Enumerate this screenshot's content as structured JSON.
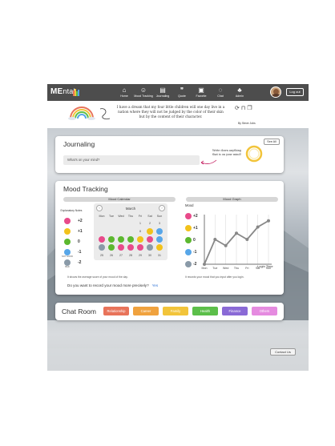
{
  "nav": {
    "logo_main": "ME",
    "logo_rest": "ntal",
    "items": [
      {
        "label": "Home",
        "icon": "home-icon",
        "glyph": "⌂"
      },
      {
        "label": "Mood Tracking",
        "icon": "smiley-icon",
        "glyph": "☺"
      },
      {
        "label": "Journaling",
        "icon": "book-icon",
        "glyph": "▤"
      },
      {
        "label": "Quote",
        "icon": "quote-icon",
        "glyph": "❞"
      },
      {
        "label": "Favorite",
        "icon": "bookmark-icon",
        "glyph": "▣"
      },
      {
        "label": "Chat",
        "icon": "chat-icon",
        "glyph": "◌"
      },
      {
        "label": "Admin",
        "icon": "admin-icon",
        "glyph": "♣"
      }
    ],
    "logout": "Log out"
  },
  "quote": {
    "text": "I have a dream that my four little children will one day live in a nation where they will not be judged by the color of their skin but by the content of their character.",
    "author": "By Steve Jobs"
  },
  "journaling": {
    "title": "Journaling",
    "see_all": "See All",
    "placeholder": "What's on your mind?",
    "note": "Write down anything that is on your mind!"
  },
  "mood": {
    "title": "Mood Tracking",
    "calendar_label": "Mood Calendar",
    "graph_label": "Mood Graph",
    "legend_title": "Explanatory Notes",
    "legend": [
      {
        "value": "+2",
        "caption": "",
        "color": "#e84a8a"
      },
      {
        "value": "+1",
        "caption": "",
        "color": "#f2c21b"
      },
      {
        "value": "0",
        "caption": "",
        "color": "#5cb82f"
      },
      {
        "value": "-1",
        "caption": "NOT GOOD",
        "color": "#57a6e8"
      },
      {
        "value": "-2",
        "caption": "BAD",
        "color": "#8a9aa8"
      }
    ],
    "calendar": {
      "month": "March",
      "weekdays": [
        "Mon",
        "Tue",
        "Wed",
        "Thu",
        "Fri",
        "Sat",
        "Sun"
      ],
      "cells": [
        {
          "row": 0,
          "col": 4,
          "day": "1"
        },
        {
          "row": 0,
          "col": 5,
          "day": "2"
        },
        {
          "row": 0,
          "col": 6,
          "day": "3"
        },
        {
          "row": 1,
          "col": 4,
          "day": "8"
        },
        {
          "row": 1,
          "col": 5,
          "day": "9",
          "mood": "+1"
        },
        {
          "row": 1,
          "col": 6,
          "day": "10",
          "mood": "-1"
        },
        {
          "row": 2,
          "col": 0,
          "mood": "+2"
        },
        {
          "row": 2,
          "col": 1,
          "mood": "0"
        },
        {
          "row": 2,
          "col": 2,
          "mood": "0"
        },
        {
          "row": 2,
          "col": 3,
          "mood": "0"
        },
        {
          "row": 2,
          "col": 4,
          "mood": "+1"
        },
        {
          "row": 2,
          "col": 5,
          "mood": "+2"
        },
        {
          "row": 2,
          "col": 6,
          "mood": "-1"
        },
        {
          "row": 3,
          "col": 0,
          "mood": "-2"
        },
        {
          "row": 3,
          "col": 1,
          "mood": "0"
        },
        {
          "row": 3,
          "col": 2,
          "mood": "+2"
        },
        {
          "row": 3,
          "col": 3,
          "mood": "+2"
        },
        {
          "row": 3,
          "col": 4,
          "mood": "+2"
        },
        {
          "row": 3,
          "col": 5,
          "mood": "-2"
        },
        {
          "row": 3,
          "col": 6,
          "mood": "+1"
        },
        {
          "row": 4,
          "col": 0,
          "day": "25"
        },
        {
          "row": 4,
          "col": 1,
          "day": "26"
        },
        {
          "row": 4,
          "col": 2,
          "day": "27"
        },
        {
          "row": 4,
          "col": 3,
          "day": "28"
        },
        {
          "row": 4,
          "col": 4,
          "day": "29"
        },
        {
          "row": 4,
          "col": 5,
          "day": "30"
        },
        {
          "row": 4,
          "col": 6,
          "day": "31"
        }
      ]
    },
    "calendar_note": "It shows the average score of your mood of the day.",
    "graph_note": "It records your mood that you input after you login.",
    "graph": {
      "y_axis_label": "Mood",
      "x_axis_label": "Login Time",
      "y_values": [
        "+2",
        "+1",
        "0",
        "-1",
        "-2"
      ],
      "x_ticks": [
        "Mon",
        "Tue",
        "Wed",
        "Thu",
        "Fri",
        "Sat",
        "Sun"
      ],
      "points": [
        -2,
        0,
        -0.5,
        0.5,
        0,
        1,
        1.5
      ]
    },
    "question": "Do you want to record your mood more precisely?",
    "question_link": "Yes"
  },
  "chat": {
    "title": "Chat Room",
    "rooms": [
      {
        "label": "Relationship",
        "color": "#e8735a"
      },
      {
        "label": "Career",
        "color": "#f0a23e"
      },
      {
        "label": "Family",
        "color": "#f2c43a"
      },
      {
        "label": "Health",
        "color": "#5cbf4a"
      },
      {
        "label": "Finance",
        "color": "#8a6ad6"
      },
      {
        "label": "Others",
        "color": "#e58be0"
      }
    ]
  },
  "footer": {
    "contact": "Contact Us"
  },
  "colors": {
    "nav": "#4d4d4d",
    "link": "#3b7bd8"
  }
}
